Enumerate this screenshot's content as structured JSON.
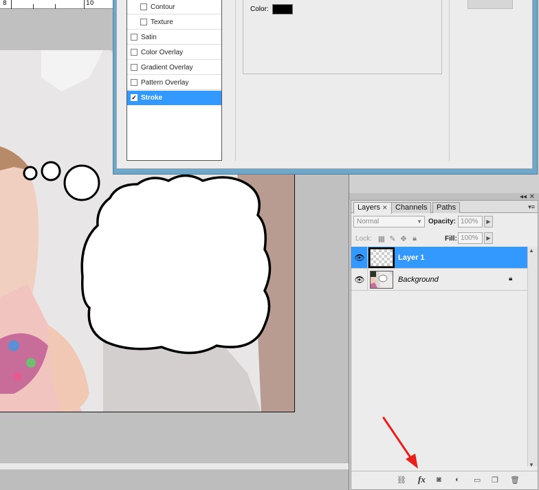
{
  "ruler": {
    "labels": [
      "8",
      "10"
    ]
  },
  "dialog": {
    "styles": [
      {
        "label": "Contour",
        "checked": false,
        "sub": true
      },
      {
        "label": "Texture",
        "checked": false,
        "sub": true
      },
      {
        "label": "Satin",
        "checked": false,
        "sub": false
      },
      {
        "label": "Color Overlay",
        "checked": false,
        "sub": false
      },
      {
        "label": "Gradient Overlay",
        "checked": false,
        "sub": false
      },
      {
        "label": "Pattern Overlay",
        "checked": false,
        "sub": false
      },
      {
        "label": "Stroke",
        "checked": true,
        "sub": false,
        "selected": true
      }
    ],
    "color_label": "Color:",
    "stroke_color": "#000000"
  },
  "layers_panel": {
    "tabs": [
      {
        "label": "Layers",
        "active": true,
        "closable": true
      },
      {
        "label": "Channels",
        "active": false
      },
      {
        "label": "Paths",
        "active": false
      }
    ],
    "blend_mode": "Normal",
    "opacity_label": "Opacity:",
    "opacity_value": "100%",
    "lock_label": "Lock:",
    "fill_label": "Fill:",
    "fill_value": "100%",
    "layers": [
      {
        "name": "Layer 1",
        "selected": true,
        "visible": true,
        "locked": false,
        "thumbnail": "transparent"
      },
      {
        "name": "Background",
        "selected": false,
        "visible": true,
        "locked": true,
        "thumbnail": "photo",
        "italic": true
      }
    ],
    "bottom_icons": [
      "link-icon",
      "fx-icon",
      "mask-icon",
      "adjustment-icon",
      "folder-icon",
      "new-layer-icon",
      "trash-icon"
    ],
    "fx_label": "fx"
  },
  "annotation": {
    "arrow_color": "#e8201c",
    "points_to": "fx-icon"
  },
  "colors": {
    "selection": "#3399ff",
    "dialog_frame": "#6ea7c7"
  }
}
